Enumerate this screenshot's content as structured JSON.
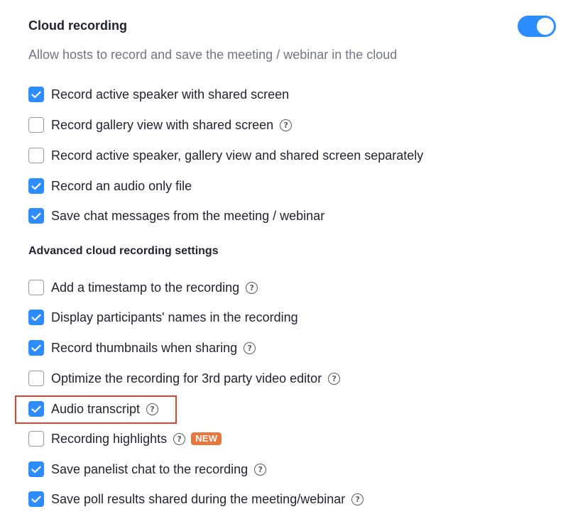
{
  "cloud_recording": {
    "title": "Cloud recording",
    "description": "Allow hosts to record and save the meeting / webinar in the cloud",
    "toggle_on": true,
    "accent_color": "#2d8cff"
  },
  "options": [
    {
      "label": "Record active speaker with shared screen",
      "checked": true,
      "help": false
    },
    {
      "label": "Record gallery view with shared screen",
      "checked": false,
      "help": true
    },
    {
      "label": "Record active speaker, gallery view and shared screen separately",
      "checked": false,
      "help": false
    },
    {
      "label": "Record an audio only file",
      "checked": true,
      "help": false
    },
    {
      "label": "Save chat messages from the meeting / webinar",
      "checked": true,
      "help": false
    }
  ],
  "advanced": {
    "heading": "Advanced cloud recording settings",
    "options": [
      {
        "label": "Add a timestamp to the recording",
        "checked": false,
        "help": true
      },
      {
        "label": "Display participants' names in the recording",
        "checked": true,
        "help": false
      },
      {
        "label": "Record thumbnails when sharing",
        "checked": true,
        "help": true
      },
      {
        "label": "Optimize the recording for 3rd party video editor",
        "checked": false,
        "help": true
      },
      {
        "label": "Audio transcript",
        "checked": true,
        "help": true,
        "highlighted": true
      },
      {
        "label": "Recording highlights",
        "checked": false,
        "help": true,
        "badge": "NEW"
      },
      {
        "label": "Save panelist chat to the recording",
        "checked": true,
        "help": true
      },
      {
        "label": "Save poll results shared during the meeting/webinar",
        "checked": true,
        "help": true
      }
    ]
  },
  "help_glyph": "?",
  "highlight_color": "#e0442f",
  "badge_color": "#e8773d"
}
